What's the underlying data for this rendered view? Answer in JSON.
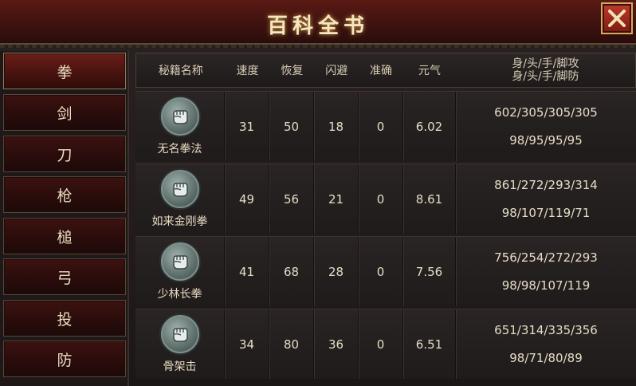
{
  "window": {
    "title": "百科全书",
    "close_icon": "close-icon"
  },
  "sidebar": {
    "items": [
      {
        "label": "拳",
        "active": true
      },
      {
        "label": "剑"
      },
      {
        "label": "刀"
      },
      {
        "label": "枪"
      },
      {
        "label": "槌"
      },
      {
        "label": "弓"
      },
      {
        "label": "投"
      },
      {
        "label": "防"
      }
    ]
  },
  "table": {
    "headers": {
      "name": "秘籍名称",
      "speed": "速度",
      "recover": "恢复",
      "dodge": "闪避",
      "accuracy": "准确",
      "yuanqi": "元气",
      "attack": "身/头/手/脚攻",
      "defense": "身/头/手/脚防"
    },
    "rows": [
      {
        "name": "无名拳法",
        "speed": "31",
        "recover": "50",
        "dodge": "18",
        "accuracy": "0",
        "yuanqi": "6.02",
        "attack": "602/305/305/305",
        "defense": "98/95/95/95",
        "icon": "fist-icon"
      },
      {
        "name": "如来金刚拳",
        "speed": "49",
        "recover": "56",
        "dodge": "21",
        "accuracy": "0",
        "yuanqi": "8.61",
        "attack": "861/272/293/314",
        "defense": "98/107/119/71",
        "icon": "fist-icon"
      },
      {
        "name": "少林长拳",
        "speed": "41",
        "recover": "68",
        "dodge": "28",
        "accuracy": "0",
        "yuanqi": "7.56",
        "attack": "756/254/272/293",
        "defense": "98/98/107/119",
        "icon": "fist-icon"
      },
      {
        "name": "骨架击",
        "speed": "34",
        "recover": "80",
        "dodge": "36",
        "accuracy": "0",
        "yuanqi": "6.51",
        "attack": "651/314/335/356",
        "defense": "98/71/80/89",
        "icon": "fist-icon"
      }
    ]
  }
}
